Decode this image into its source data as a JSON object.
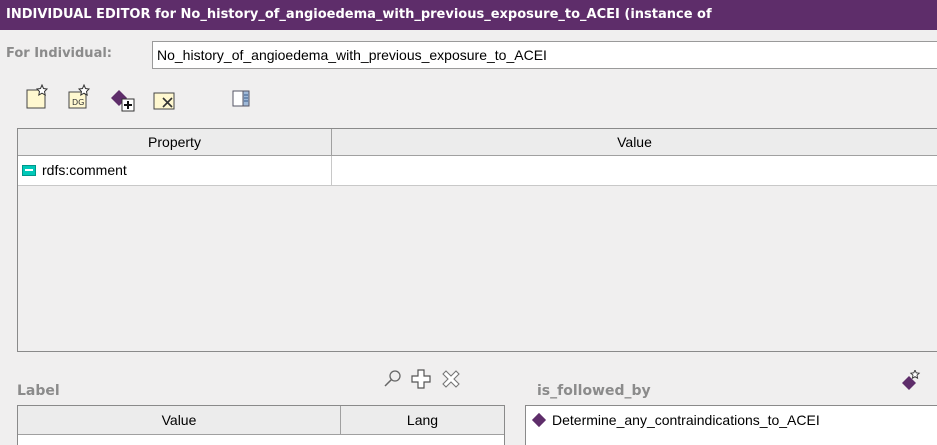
{
  "window": {
    "title": "INDIVIDUAL EDITOR for No_history_of_angioedema_with_previous_exposure_to_ACEI  (instance of"
  },
  "individual": {
    "label": "For Individual:",
    "value": "No_history_of_angioedema_with_previous_exposure_to_ACEI"
  },
  "toolbar": {
    "buttons": [
      "create-class-icon",
      "create-slot-icon",
      "add-instance-icon",
      "delete-instance-icon",
      "show-form-icon"
    ]
  },
  "properties": {
    "columns": [
      "Property",
      "Value"
    ],
    "rows": [
      {
        "property": "rdfs:comment",
        "value": ""
      }
    ]
  },
  "label_panel": {
    "title": "Label",
    "columns": [
      "Value",
      "Lang"
    ],
    "tools": [
      "search-icon",
      "add-icon",
      "remove-icon"
    ]
  },
  "is_followed_by": {
    "title": "is_followed_by",
    "items": [
      "Determine_any_contraindications_to_ACEI"
    ]
  },
  "colors": {
    "title_bar": "#5e2d6a",
    "annotation_icon": "#00c8b8",
    "instance_diamond": "#5e2d6a"
  }
}
